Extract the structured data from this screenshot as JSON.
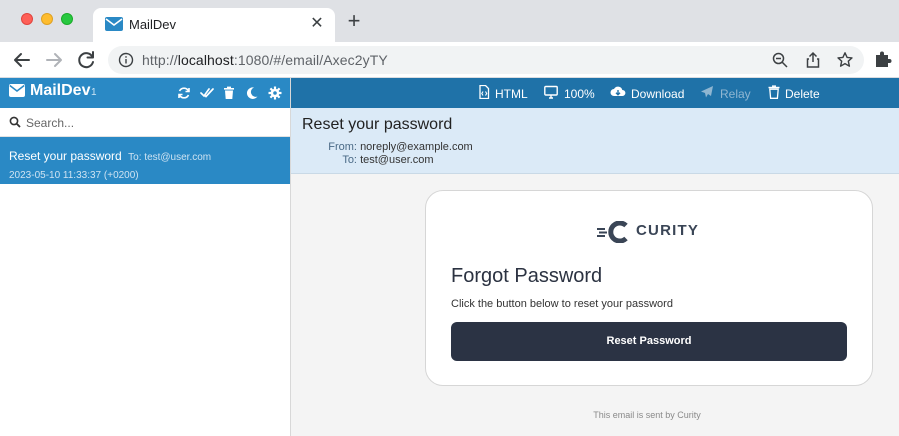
{
  "browser": {
    "tab_title": "MailDev",
    "tab_close": "✕",
    "new_tab": "+",
    "url_host": "localhost",
    "url_prefix": "http://",
    "url_rest": ":1080/#/email/Axec2yTY"
  },
  "app": {
    "brand": "MailDev",
    "count": "1",
    "search_placeholder": "Search...",
    "colors": {
      "sidebar_header": "#2a89c5",
      "toolbar": "#1f72a8",
      "selected": "#2a89c5",
      "meta_bg": "#dbeaf7",
      "button": "#2b3344"
    }
  },
  "mail_list": [
    {
      "subject": "Reset your password",
      "to": "To: test@user.com",
      "date": "2023-05-10 11:33:37 (+0200)"
    }
  ],
  "toolbar": {
    "html": "HTML",
    "zoom": "100%",
    "download": "Download",
    "relay": "Relay",
    "delete": "Delete"
  },
  "message": {
    "subject": "Reset your password",
    "from_label": "From:",
    "from": "noreply@example.com",
    "to_label": "To:",
    "to": "test@user.com"
  },
  "email": {
    "logo_text": "CURITY",
    "title": "Forgot Password",
    "text": "Click the button below to reset your password",
    "button": "Reset Password",
    "footer": "This email is sent by Curity"
  }
}
